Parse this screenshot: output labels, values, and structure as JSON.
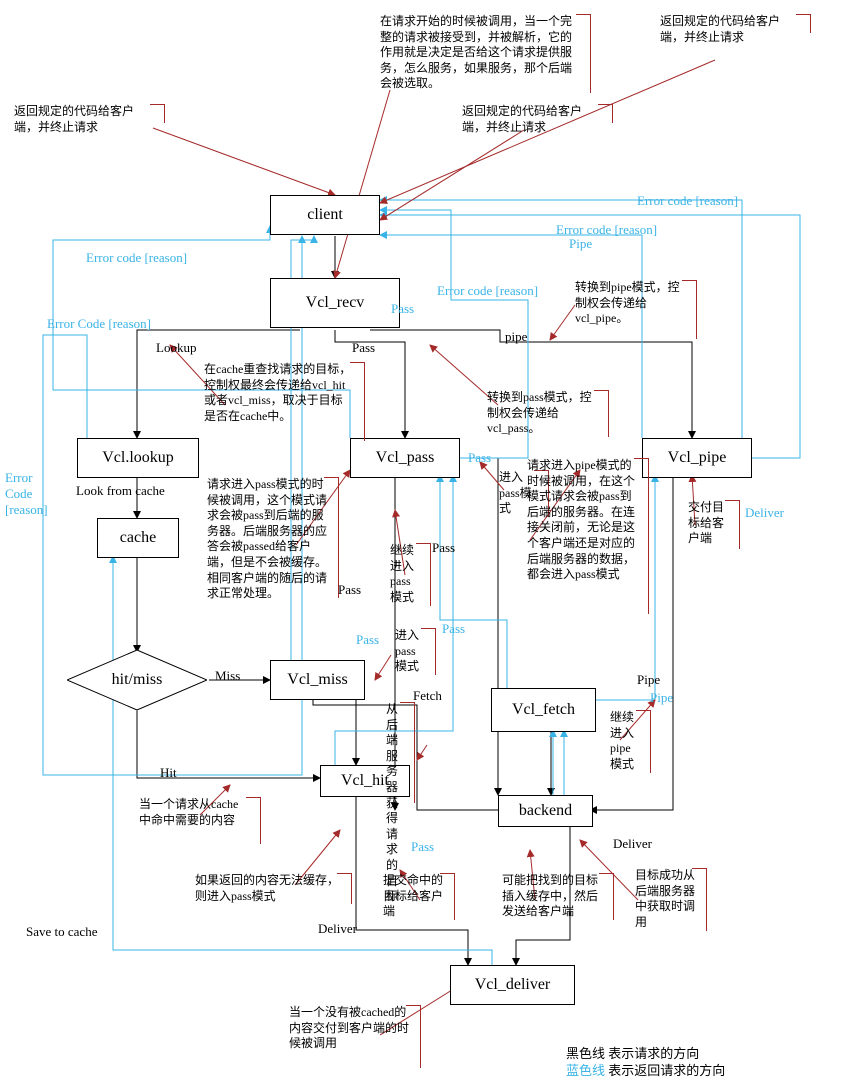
{
  "nodes": {
    "client": "client",
    "vcl_recv": "Vcl_recv",
    "vcl_lookup": "Vcl.lookup",
    "cache": "cache",
    "hit_miss": "hit/miss",
    "vcl_miss": "Vcl_miss",
    "vcl_hit": "Vcl_hit",
    "vcl_pass": "Vcl_pass",
    "vcl_pipe": "Vcl_pipe",
    "vcl_fetch": "Vcl_fetch",
    "backend": "backend",
    "vcl_deliver": "Vcl_deliver"
  },
  "notes": {
    "n_return_top_right": "返回规定的代码给客户端，并终止请求",
    "n_return_left": "返回规定的代码给客户端，并终止请求",
    "n_return_mid": "返回规定的代码给客户端，并终止请求",
    "n_recv_desc": "在请求开始的时候被调用，当一个完整的请求被接受到，并被解析，它的作用就是决定是否给这个请求提供服务，怎么服务，如果服务，那个后端会被选取。",
    "n_lookup_desc": "在cache重查找请求的目标，控制权最终会传递给vcl_hit或者vcl_miss，取决于目标是否在cache中。",
    "n_pass_mode": "转换到pass模式，控制权会传递给vcl_pass。",
    "n_pipe_mode": "转换到pipe模式，控制权会传递给vcl_pipe。",
    "n_pass_desc": "请求进入pass模式的时候被调用，这个模式请求会被pass到后端的服务器。后端服务器的应答会被passed给客户端，但是不会被缓存。相同客户端的随后的请求正常处理。",
    "n_enter_pass": "进入pass模式",
    "n_continue_pass": "继续进入pass模式",
    "n_pipe_desc": "请求进入pipe模式的时候被调用，在这个模式请求会被pass到后端的服务器。在连接关闭前，无论是这个客户端还是对应的后端服务器的数据，都会进入pass模式",
    "n_deliver_target": "交付目标给客户端",
    "n_enter_pass2": "进入pass模式",
    "n_fetch_desc": "从后端服务器获得请求的目标",
    "n_continue_pipe": "继续进入pipe模式",
    "n_hit_desc": "当一个请求从cache中命中需要的内容",
    "n_no_cache_pass": "如果返回的内容无法缓存，则进入pass模式",
    "n_submit_hit": "提交命中的目标给客户端",
    "n_insert_cache": "可能把找到的目标插入缓存中，然后发送给客户端",
    "n_fetch_deliver": "目标成功从后端服务器中获取时调用",
    "n_deliver_desc": "当一个没有被cached的内容交付到客户端的时候被调用"
  },
  "edge_labels": {
    "error_code_reason1": "Error code [reason]",
    "error_code_reason2": "Error code [reason]",
    "error_code_reason3": "Error code [reason]",
    "error_code_reason4": "Error code [reason]",
    "error_code_reason5": "Error Code [reason]",
    "error_code_reason6": "Error Code [reason]",
    "lookup": "Lookup",
    "pass": "Pass",
    "pass_blue": "Pass",
    "pipe": "pipe",
    "pipe_label": "Pipe",
    "look_from_cache": "Look from cache",
    "miss": "Miss",
    "hit": "Hit",
    "fetch": "Fetch",
    "deliver": "Deliver",
    "deliver_blue": "Deliver",
    "deliver2": "Deliver",
    "save_to_cache": "Save to cache",
    "pipe2": "Pipe"
  },
  "legend": {
    "black": "黑色线  表示请求的方向",
    "blue_prefix": "蓝色线",
    "blue_rest": "  表示返回请求的方向"
  }
}
